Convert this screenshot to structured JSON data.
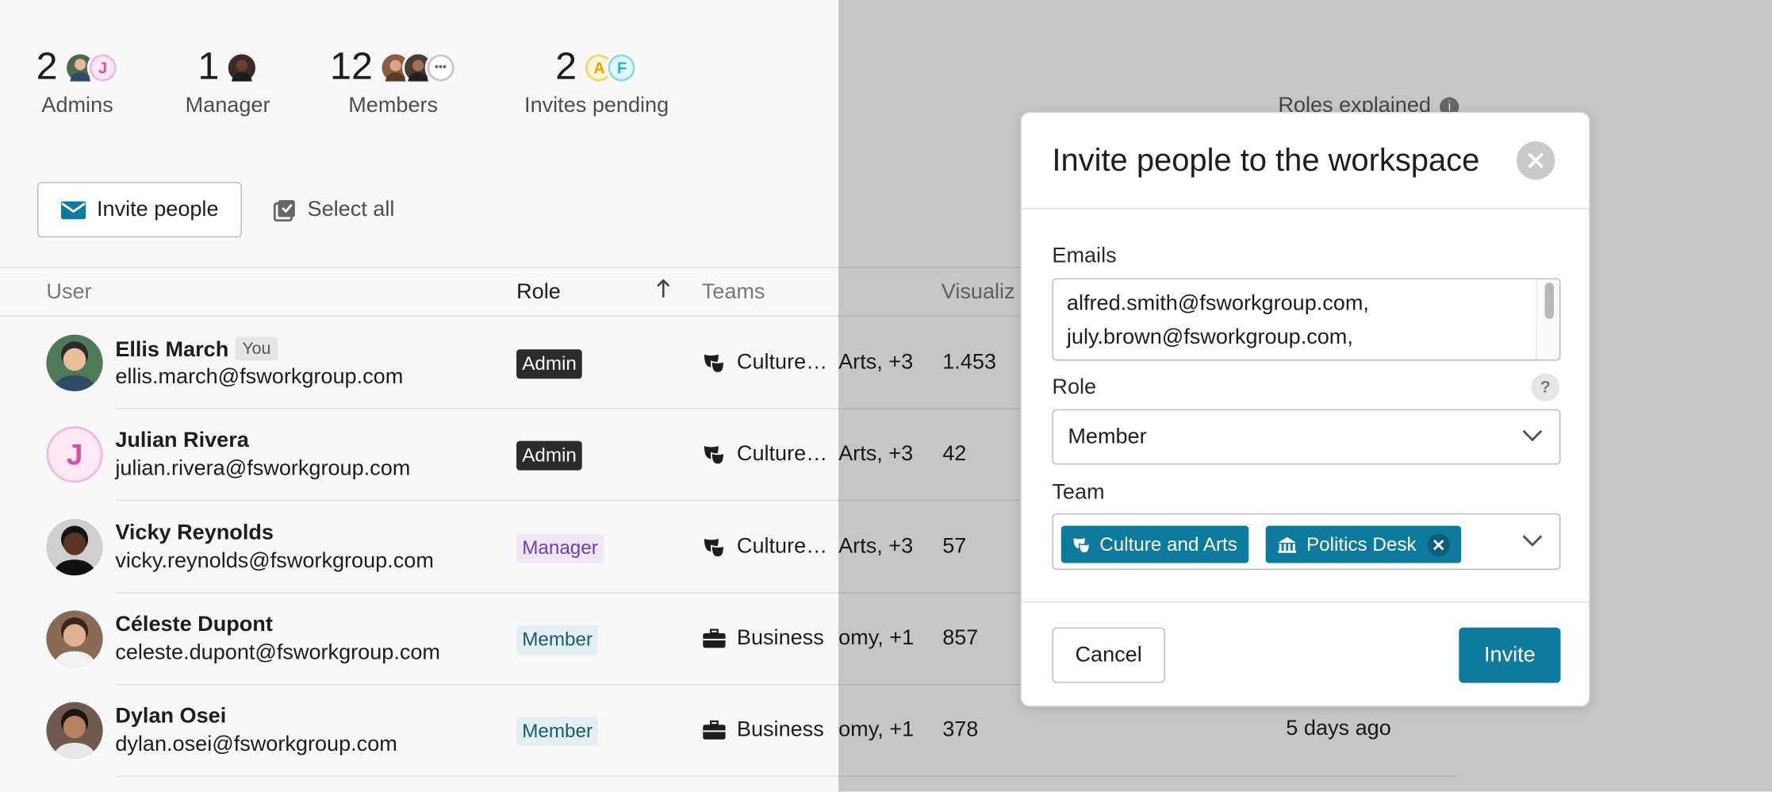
{
  "stats": [
    {
      "count": "2",
      "label": "Admins",
      "avatars": [
        {
          "type": "photo",
          "tone": "#4a6b4f"
        },
        {
          "type": "letter",
          "letter": "J",
          "color": "#d84fa6",
          "bg": "#fde8f4"
        }
      ]
    },
    {
      "count": "1",
      "label": "Manager",
      "avatars": [
        {
          "type": "photo",
          "tone": "#3c2b25"
        }
      ]
    },
    {
      "count": "12",
      "label": "Members",
      "avatars": [
        {
          "type": "photo",
          "tone": "#8b5d45"
        },
        {
          "type": "photo",
          "tone": "#4b3b32"
        },
        {
          "type": "more",
          "letter": "•••"
        }
      ]
    },
    {
      "count": "2",
      "label": "Invites pending",
      "avatars": [
        {
          "type": "letter",
          "letter": "A",
          "color": "#e0a800",
          "bg": "#fff6d9"
        },
        {
          "type": "letter",
          "letter": "F",
          "color": "#2bb4c5",
          "bg": "#e2f6f9"
        }
      ]
    }
  ],
  "toolbar": {
    "invite_label": "Invite people",
    "select_all_label": "Select all"
  },
  "table": {
    "headers": {
      "user": "User",
      "role": "Role",
      "teams": "Teams",
      "visualizations": "Visualiz"
    },
    "rows": [
      {
        "name": "Ellis March",
        "you": "You",
        "email": "ellis.march@fsworkgroup.com",
        "role": "Admin",
        "role_kind": "admin",
        "team": "Culture…",
        "team_tail": "Arts, +3",
        "team_icon": "culture",
        "vis": "1.453",
        "last_seen": ""
      },
      {
        "name": "Julian Rivera",
        "you": "",
        "email": "julian.rivera@fsworkgroup.com",
        "role": "Admin",
        "role_kind": "admin",
        "team": "Culture…",
        "team_tail": "Arts, +3",
        "team_icon": "culture",
        "vis": "42",
        "last_seen": ""
      },
      {
        "name": "Vicky Reynolds",
        "you": "",
        "email": "vicky.reynolds@fsworkgroup.com",
        "role": "Manager",
        "role_kind": "manager",
        "team": "Culture…",
        "team_tail": "Arts, +3",
        "team_icon": "culture",
        "vis": "57",
        "last_seen": ""
      },
      {
        "name": "Céleste Dupont",
        "you": "",
        "email": "celeste.dupont@fsworkgroup.com",
        "role": "Member",
        "role_kind": "member",
        "team": "Business",
        "team_tail": "omy, +1",
        "team_icon": "business",
        "vis": "857",
        "last_seen": ""
      },
      {
        "name": "Dylan Osei",
        "you": "",
        "email": "dylan.osei@fsworkgroup.com",
        "role": "Member",
        "role_kind": "member",
        "team": "Business",
        "team_tail": "omy, +1",
        "team_icon": "business",
        "vis": "378",
        "last_seen": "5 days ago"
      }
    ]
  },
  "roles_explained": "Roles explained",
  "modal": {
    "title": "Invite people to the workspace",
    "emails_label": "Emails",
    "emails": [
      "alfred.smith@fsworkgroup.com,",
      "july.brown@fsworkgroup.com,"
    ],
    "role_label": "Role",
    "role_value": "Member",
    "help_glyph": "?",
    "team_label": "Team",
    "chips": [
      {
        "label": "Culture and Arts",
        "icon": "culture",
        "removable": false
      },
      {
        "label": "Politics Desk",
        "icon": "politics",
        "removable": true
      }
    ],
    "cancel_label": "Cancel",
    "invite_label": "Invite"
  },
  "colors": {
    "accent": "#0d7a9e",
    "admin_badge": "#2b2b2b",
    "manager_badge": "#efe7f7",
    "member_badge": "#e3eff3"
  }
}
